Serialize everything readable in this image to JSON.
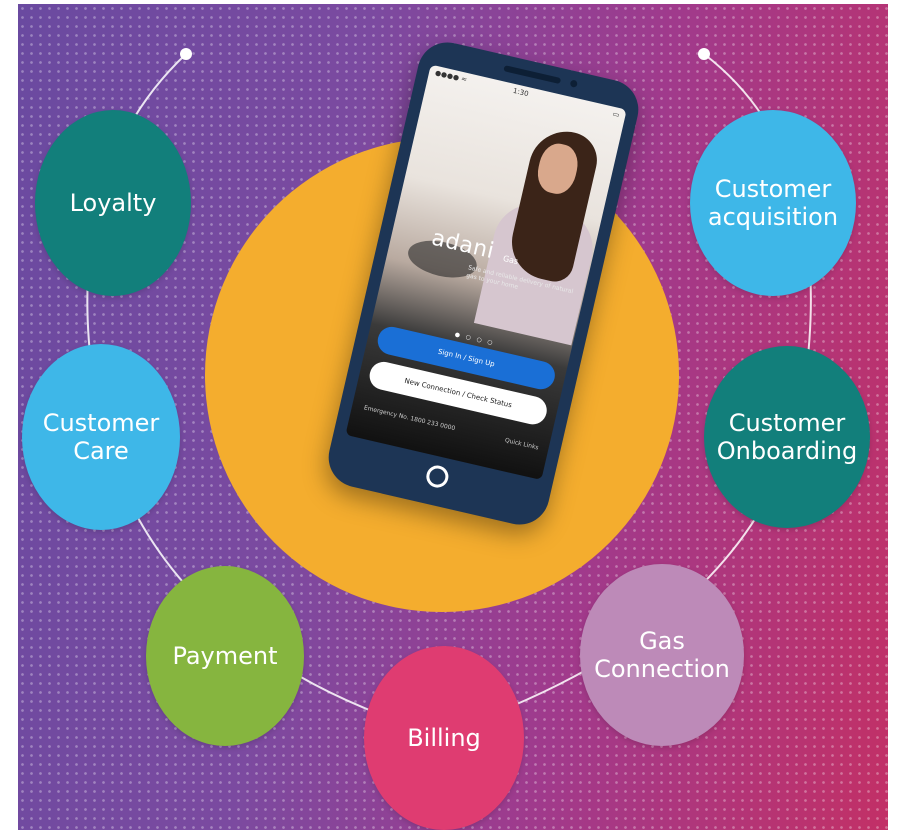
{
  "colors": {
    "big_circle": "#f4ad2e",
    "loyalty": "#127f7b",
    "customer_care": "#3eb7e8",
    "payment": "#86b53f",
    "billing": "#df3c71",
    "gas_connection": "#bd8ab8",
    "customer_onboarding": "#127f7b",
    "customer_acquisition": "#3eb7e8",
    "orbit_line": "#ffffff"
  },
  "bubbles": [
    {
      "id": "loyalty",
      "label": "Loyalty"
    },
    {
      "id": "customer_care",
      "label": "Customer\nCare"
    },
    {
      "id": "payment",
      "label": "Payment"
    },
    {
      "id": "billing",
      "label": "Billing"
    },
    {
      "id": "gas_connection",
      "label": "Gas\nConnection"
    },
    {
      "id": "customer_onboarding",
      "label": "Customer\nOnboarding"
    },
    {
      "id": "customer_acquisition",
      "label": "Customer\nacquisition"
    }
  ],
  "phone": {
    "brand": "adani",
    "brand_sub": "Gas",
    "tagline": "Safe and reliable delivery of natural gas to your home",
    "primary_button": "Sign In / Sign Up",
    "secondary_button": "New Connection / Check Status",
    "emergency": "Emergency No. 1800 233 0000",
    "quick_link": "Quick Links"
  }
}
